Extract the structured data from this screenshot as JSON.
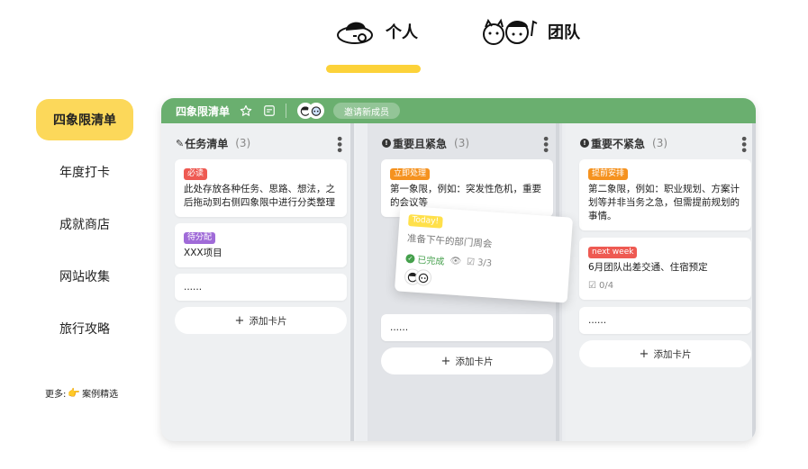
{
  "switch": {
    "personal_label": "个人",
    "team_label": "团队"
  },
  "sidebar": {
    "items": [
      {
        "label": "四象限清单",
        "active": true
      },
      {
        "label": "年度打卡"
      },
      {
        "label": "成就商店"
      },
      {
        "label": "网站收集"
      },
      {
        "label": "旅行攻略"
      }
    ],
    "more_prefix": "更多:",
    "more_link": "案例精选"
  },
  "board": {
    "title": "四象限清单",
    "invite_label": "邀请新成员",
    "accent": "#6aaf6f",
    "columns": [
      {
        "title": "任务清单",
        "count": "(3)",
        "cards": [
          {
            "tag": "必读",
            "tag_color": "#ee5a52",
            "text": "此处存放各种任务、思路、想法，之后拖动到右侧四象限中进行分类整理"
          },
          {
            "tag": "待分配",
            "tag_color": "#a06bd8",
            "text": "XXX项目"
          },
          {
            "text": "......"
          }
        ],
        "add_label": "添加卡片"
      },
      {
        "title": "重要且紧急",
        "count": "(3)",
        "cards": [
          {
            "tag": "立即处理",
            "tag_color": "#f5921f",
            "text": "第一象限，例如：突发性危机，重要的会议等"
          },
          {
            "text": "......"
          }
        ],
        "add_label": "添加卡片"
      },
      {
        "title": "重要不紧急",
        "count": "(3)",
        "cards": [
          {
            "tag": "提前安排",
            "tag_color": "#f5921f",
            "text": "第二象限，例如：职业规划、方案计划等并非当务之急，但需提前规划的事情。"
          },
          {
            "tag": "next week",
            "tag_color": "#ee5a52",
            "text": "6月团队出差交通、住宿预定",
            "checklist": "0/4"
          },
          {
            "text": "......"
          }
        ],
        "add_label": "添加卡片"
      }
    ],
    "dragged_card": {
      "tag": "Today!",
      "text": "准备下午的部门周会",
      "status": "已完成",
      "checklist": "3/3"
    }
  }
}
